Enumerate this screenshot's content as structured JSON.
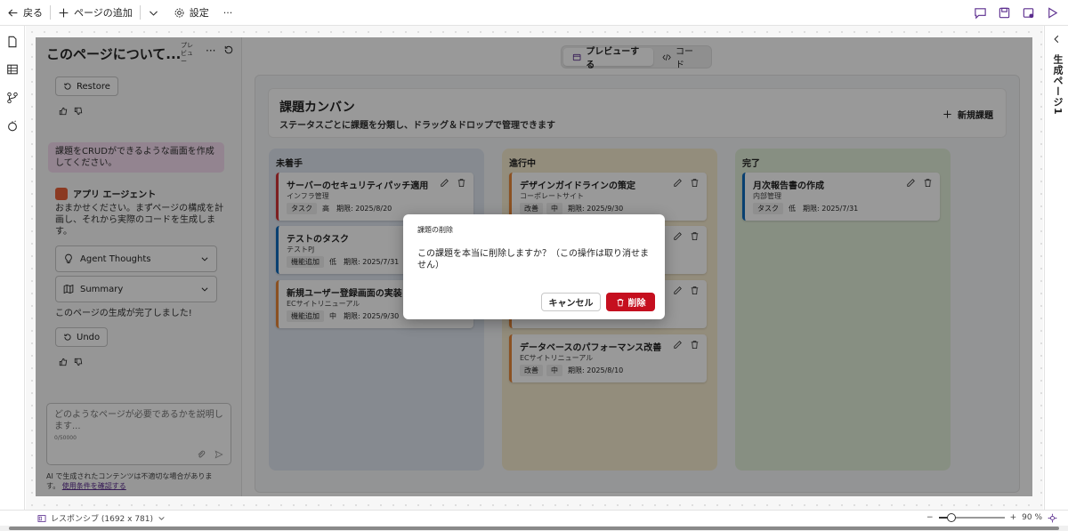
{
  "toolbar": {
    "back_label": "戻る",
    "add_page_label": "ページの追加",
    "settings_label": "設定",
    "more_label": "···"
  },
  "right_rail": {
    "page_label": "生成ページ1"
  },
  "chat_panel": {
    "title": "このページについて...",
    "preview_tag": "プレビュー",
    "restore_label": "Restore",
    "user_message": "課題をCRUDができるような画面を作成してください。",
    "agent_name": "アプリ エージェント",
    "agent_message": "おまかせください。まずページの構成を計画し、それから実際のコードを生成します。",
    "thoughts_label": "Agent Thoughts",
    "summary_label": "Summary",
    "done_message": "このページの生成が完了しました!",
    "undo_label": "Undo",
    "prompt_placeholder": "どのようなページが必要であるかを説明します...",
    "prompt_count": "0/50000",
    "disclaimer": "AI で生成されたコンテンツは不適切な場合があります。",
    "disclaimer_link": "使用条件を確認する"
  },
  "view_toggle": {
    "preview_label": "プレビューする",
    "code_label": "コード"
  },
  "board": {
    "title": "課題カンバン",
    "subtitle": "ステータスごとに課題を分類し、ドラッグ＆ドロップで管理できます",
    "new_label": "新規課題",
    "columns": [
      {
        "title": "未着手",
        "color": "#dfe6f0",
        "cards": [
          {
            "title": "サーバーのセキュリティパッチ適用",
            "project": "インフラ管理",
            "type": "タスク",
            "priority": "高",
            "due": "期限: 2025/8/20",
            "accent": "#d13438"
          },
          {
            "title": "テストのタスク",
            "project": "テストPJ",
            "type": "機能追加",
            "priority": "低",
            "due": "期限: 2025/7/31",
            "accent": "#0f6cbd"
          },
          {
            "title": "新規ユーザー登録画面の実装",
            "project": "ECサイトリニューアル",
            "type": "機能追加",
            "priority": "中",
            "due": "期限: 2025/9/30",
            "accent": "#e8873a"
          }
        ]
      },
      {
        "title": "進行中",
        "color": "#f6ebcf",
        "cards": [
          {
            "title": "デザインガイドラインの策定",
            "project": "コーポレートサイト",
            "type": "改善",
            "priority": "中",
            "due": "期限: 2025/9/30",
            "accent": "#e8873a"
          },
          {
            "title": "データベースのパフォーマンス改善",
            "project": "ECサイトリニューアル",
            "type": "改善",
            "priority": "中",
            "due": "期限: 2025/8/10",
            "accent": "#e8873a"
          }
        ]
      },
      {
        "title": "完了",
        "color": "#e2eed9",
        "cards": [
          {
            "title": "月次報告書の作成",
            "project": "内部管理",
            "type": "タスク",
            "priority": "低",
            "due": "期限: 2025/7/31",
            "accent": "#0f6cbd"
          }
        ]
      }
    ]
  },
  "dialog": {
    "title": "課題の削除",
    "message": "この課題を本当に削除しますか？（この操作は取り消せません）",
    "cancel_label": "キャンセル",
    "delete_label": "削除"
  },
  "status_bar": {
    "responsive_label": "レスポンシブ (1692 x 781)",
    "zoom_minus": "−",
    "zoom_plus": "+",
    "zoom_value": "90 %",
    "zoom_level": 0.2
  },
  "colors": {
    "accent": "#5b2d8e",
    "danger": "#c50f1f"
  }
}
